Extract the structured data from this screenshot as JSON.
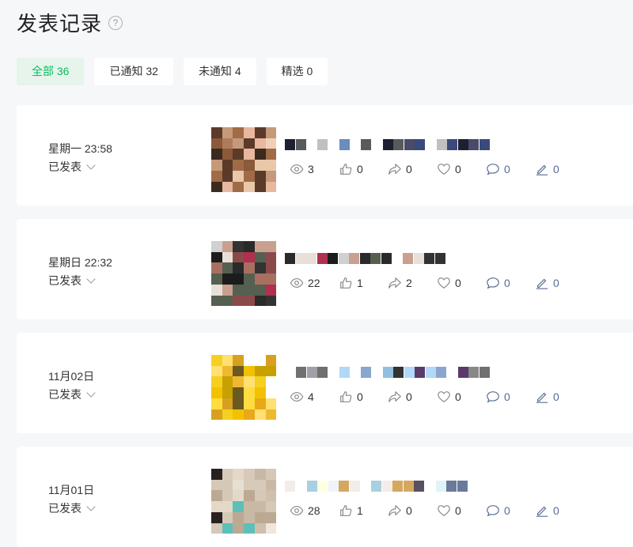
{
  "page": {
    "title": "发表记录",
    "help_icon": "?"
  },
  "tabs": [
    {
      "label": "全部 36",
      "active": true
    },
    {
      "label": "已通知 32"
    },
    {
      "label": "未通知 4"
    },
    {
      "label": "精选 0"
    }
  ],
  "records": [
    {
      "date": "星期一 23:58",
      "status": "已发表",
      "views": "3",
      "likes": "0",
      "shares": "0",
      "favorites": "0",
      "comments": "0",
      "notes": "0"
    },
    {
      "date": "星期日 22:32",
      "status": "已发表",
      "views": "22",
      "likes": "1",
      "shares": "2",
      "favorites": "0",
      "comments": "0",
      "notes": "0"
    },
    {
      "date": "11月02日",
      "status": "已发表",
      "views": "4",
      "likes": "0",
      "shares": "0",
      "favorites": "0",
      "comments": "0",
      "notes": "0"
    },
    {
      "date": "11月01日",
      "status": "已发表",
      "views": "28",
      "likes": "1",
      "shares": "0",
      "favorites": "0",
      "comments": "0",
      "notes": "0"
    }
  ],
  "colors": {
    "accent": "#07c160",
    "accent_bg": "#e6f4ec",
    "link_blue": "#576b95"
  },
  "icons": [
    "eye-icon",
    "thumbs-up-icon",
    "share-icon",
    "heart-icon",
    "comment-icon",
    "pen-icon",
    "chevron-down-icon",
    "help-icon"
  ]
}
